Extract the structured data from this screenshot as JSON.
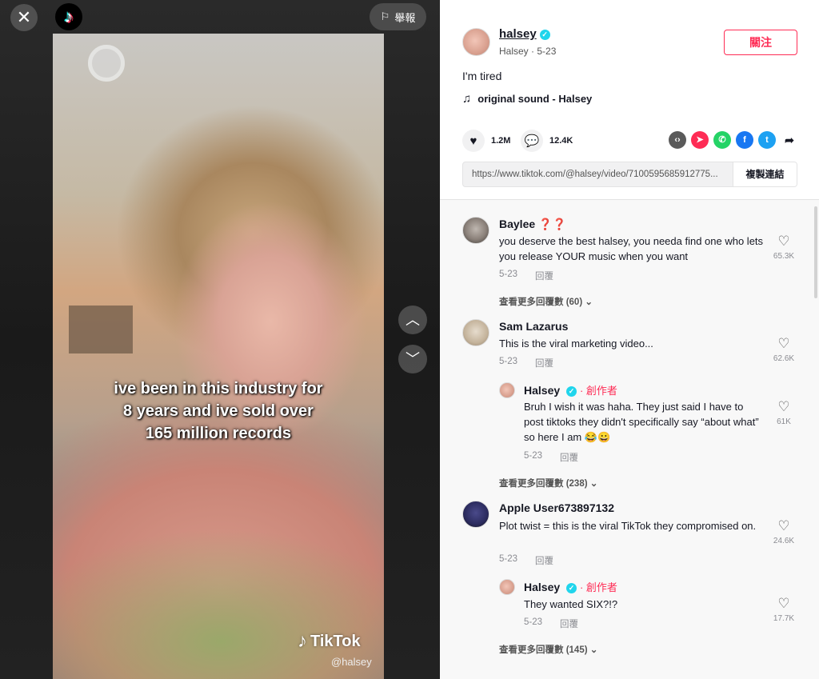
{
  "video": {
    "overlay_lines": [
      "ive been in this industry for",
      "8 years and ive sold over",
      "165 million records"
    ],
    "watermark_brand": "TikTok",
    "watermark_handle": "@halsey",
    "report_label": "舉報"
  },
  "post": {
    "author": "halsey",
    "display_name": "Halsey",
    "date": "5-23",
    "follow_label": "關注",
    "caption": "I'm tired",
    "music": "original sound - Halsey",
    "likes": "1.2M",
    "comments": "12.4K",
    "link": "https://www.tiktok.com/@halsey/video/7100595685912775...",
    "copy_label": "複製連結",
    "share_icons": [
      {
        "name": "embed-icon",
        "color": "#5a5a5a"
      },
      {
        "name": "send-icon",
        "color": "#fe2c55"
      },
      {
        "name": "whatsapp-icon",
        "color": "#25d366"
      },
      {
        "name": "facebook-icon",
        "color": "#1877f2"
      },
      {
        "name": "twitter-icon",
        "color": "#1da1f2"
      },
      {
        "name": "forward-icon",
        "color": "#161823"
      }
    ]
  },
  "comments": [
    {
      "user": "Baylee ❓❓",
      "text": "you deserve the best halsey, you needa find one who lets you release YOUR music when you want",
      "date": "5-23",
      "reply_label": "回覆",
      "likes": "65.3K",
      "more_replies": "查看更多回覆數 (60)"
    },
    {
      "user": "Sam Lazarus",
      "text": "This is the viral marketing video...",
      "date": "5-23",
      "reply_label": "回覆",
      "likes": "62.6K",
      "reply": {
        "user": "Halsey",
        "badge": "· 創作者",
        "text": "Bruh I wish it was haha. They just said I have to post tiktoks they didn't specifically say “about what” so here I am 😂😀",
        "date": "5-23",
        "reply_label": "回覆",
        "likes": "61K"
      },
      "more_replies": "查看更多回覆數 (238)"
    },
    {
      "user": "Apple User673897132",
      "text": "Plot twist = this is the viral TikTok they compromised on.",
      "date": "5-23",
      "reply_label": "回覆",
      "likes": "24.6K",
      "reply": {
        "user": "Halsey",
        "badge": "· 創作者",
        "text": "They wanted SIX?!?",
        "date": "5-23",
        "reply_label": "回覆",
        "likes": "17.7K"
      },
      "more_replies": "查看更多回覆數 (145)"
    }
  ],
  "colors": {
    "accent": "#fe2c55",
    "verified": "#20d5ec",
    "text": "#161823",
    "muted": "#8a8b91"
  }
}
